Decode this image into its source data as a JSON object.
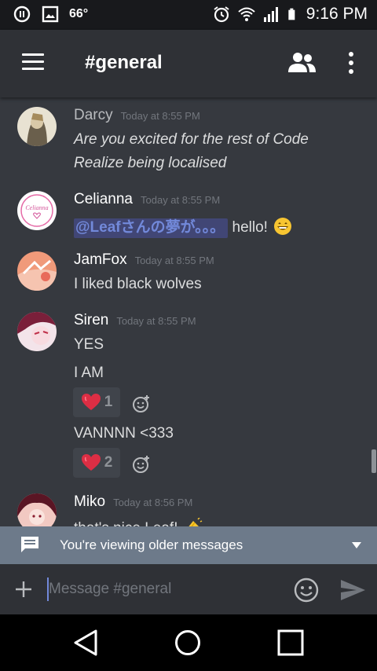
{
  "status_bar": {
    "temperature": "66°",
    "time": "9:16 PM",
    "icons": [
      "pause-circle-icon",
      "image-icon",
      "alarm-clock-icon",
      "wifi-icon",
      "signal-icon",
      "battery-icon"
    ]
  },
  "header": {
    "channel": "#general",
    "icons": [
      "hamburger-menu-icon",
      "members-icon",
      "more-vertical-icon"
    ]
  },
  "messages": [
    {
      "author": "Darcy",
      "timestamp": "Today at 8:55 PM",
      "lines": [
        "Are you excited for the rest of Code",
        "Realize being localised"
      ]
    },
    {
      "author": "Celianna",
      "timestamp": "Today at 8:55 PM",
      "avatar_text": "Celianna",
      "mention": "@Leafさんの夢が。。。",
      "text": "hello!",
      "emoji": "grinning-face-emoji"
    },
    {
      "author": "JamFox",
      "timestamp": "Today at 8:55 PM",
      "lines": [
        "I liked black wolves"
      ]
    },
    {
      "author": "Siren",
      "timestamp": "Today at 8:55 PM",
      "lines": [
        "YES",
        "I AM",
        "VANNNN <333"
      ],
      "reactions": [
        {
          "emoji": "heart-icon",
          "count": "1"
        },
        {
          "emoji": "heart-icon",
          "count": "2"
        }
      ]
    },
    {
      "author": "Miko",
      "timestamp": "Today at 8:56 PM",
      "lines": [
        "that's nice Leaf!"
      ],
      "emoji": "clapping-hands-emoji"
    }
  ],
  "older_messages_bar": {
    "text": "You're viewing older messages"
  },
  "composer": {
    "placeholder": "Message #general"
  },
  "colors": {
    "background": "#36393f",
    "header": "#2f3136",
    "mention_bg": "#414675",
    "mention_text": "#7289da",
    "older_bar": "#6d7a8a",
    "reaction_bg": "#40444b"
  }
}
